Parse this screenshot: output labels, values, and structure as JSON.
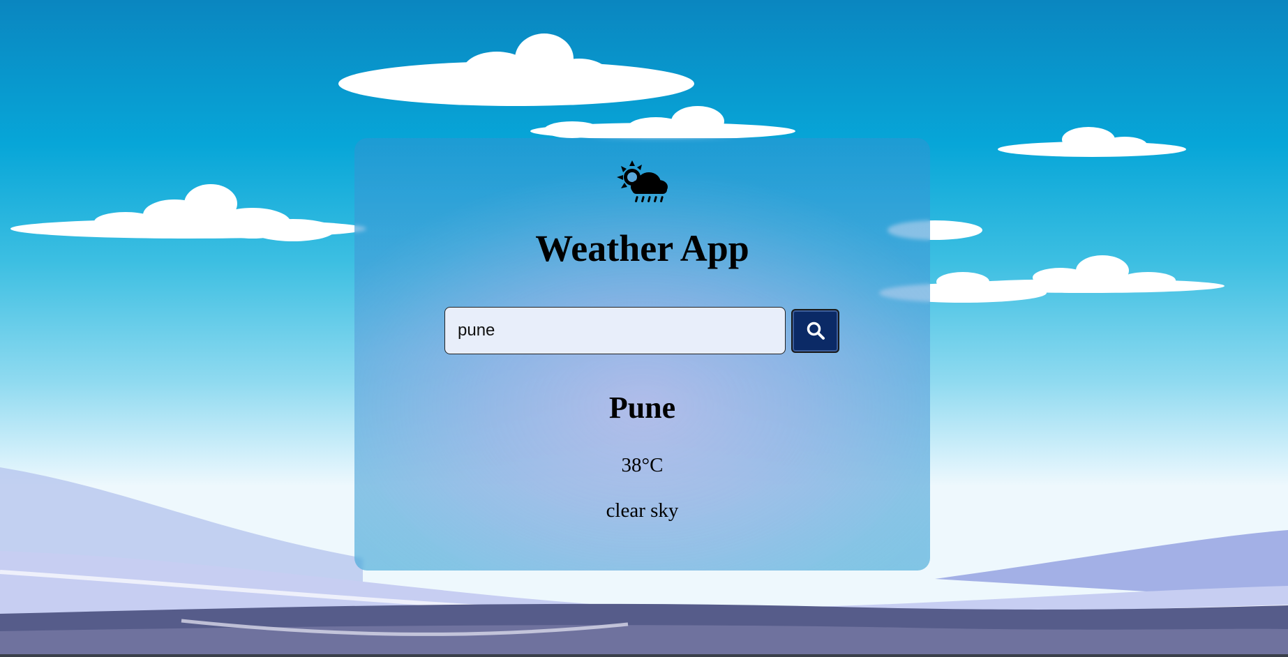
{
  "app": {
    "title": "Weather App",
    "logo_icon": "sun-cloud-rain-icon"
  },
  "search": {
    "value": "pune",
    "placeholder": "",
    "button_icon": "search-icon"
  },
  "weather": {
    "city": "Pune",
    "temperature": "38°C",
    "description": "clear sky"
  },
  "colors": {
    "search_button": "#0b2a66",
    "input_background": "#e8eefa"
  }
}
